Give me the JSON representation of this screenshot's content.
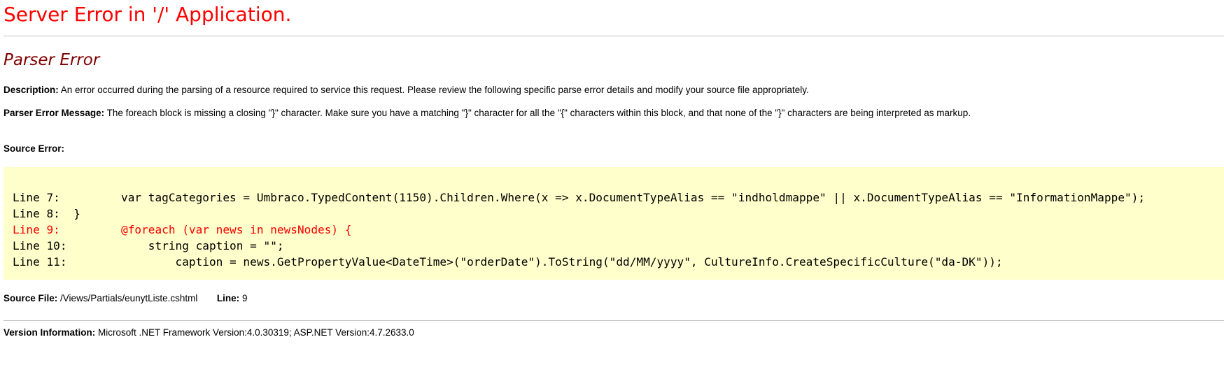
{
  "title": "Server Error in '/' Application.",
  "subtitle": "Parser Error",
  "description": {
    "label": "Description:",
    "text": "An error occurred during the parsing of a resource required to service this request. Please review the following specific parse error details and modify your source file appropriately."
  },
  "parser_error": {
    "label": "Parser Error Message:",
    "text": "The foreach block is missing a closing \"}\" character.  Make sure you have a matching \"}\" character for all the \"{\" characters within this block, and that none of the \"}\" characters are being interpreted as markup."
  },
  "source_error": {
    "label": "Source Error:",
    "lines": [
      "Line 7:         var tagCategories = Umbraco.TypedContent(1150).Children.Where(x => x.DocumentTypeAlias == \"indholdmappe\" || x.DocumentTypeAlias == \"InformationMappe\");",
      "Line 8:  }",
      "Line 9:         @foreach (var news in newsNodes) {",
      "Line 10:            string caption = \"\";",
      "Line 11:                caption = news.GetPropertyValue<DateTime>(\"orderDate\").ToString(\"dd/MM/yyyy\", CultureInfo.CreateSpecificCulture(\"da-DK\"));"
    ],
    "highlight_line": "Line 9"
  },
  "source_file": {
    "label": "Source File:",
    "value": "/Views/Partials/eunytListe.cshtml",
    "line_label": "Line:",
    "line_value": "9"
  },
  "version": {
    "label": "Version Information:",
    "text": "Microsoft .NET Framework Version:4.0.30319; ASP.NET Version:4.7.2633.0"
  },
  "colors": {
    "title": "#ff0000",
    "subtitle": "#800000",
    "code_background": "#ffffcc",
    "error_line": "#ff0000",
    "rule": "#c0c0c0"
  }
}
